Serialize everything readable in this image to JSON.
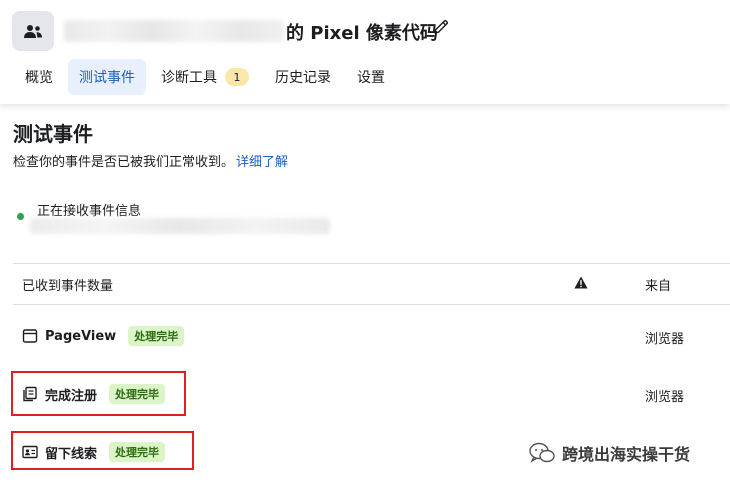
{
  "header": {
    "title_suffix": "的 Pixel 像素代码",
    "tabs": [
      {
        "label": "概览"
      },
      {
        "label": "测试事件"
      },
      {
        "label": "诊断工具",
        "badge": "1"
      },
      {
        "label": "历史记录"
      },
      {
        "label": "设置"
      }
    ]
  },
  "main": {
    "title": "测试事件",
    "description": "检查你的事件是否已被我们正常收到。",
    "learn_more": "详细了解",
    "status": "正在接收事件信息"
  },
  "table": {
    "col_name": "已收到事件数量",
    "col_source": "来自",
    "rows": [
      {
        "name": "PageView",
        "status": "处理完毕",
        "source": "浏览器",
        "icon": "browser-window-icon"
      },
      {
        "name": "完成注册",
        "status": "处理完毕",
        "source": "浏览器",
        "icon": "registration-form-icon"
      },
      {
        "name": "留下线索",
        "status": "处理完毕",
        "source": "",
        "icon": "contact-card-icon"
      }
    ]
  },
  "watermark": {
    "text": "跨境出海实操干货"
  },
  "colors": {
    "accent_blue": "#1b5fc1",
    "active_tab_bg": "#e7f0fc",
    "status_green": "#31a24c",
    "badge_green_bg": "#dcf5c8",
    "badge_green_text": "#2d6a12",
    "highlight_red": "#e02020"
  }
}
